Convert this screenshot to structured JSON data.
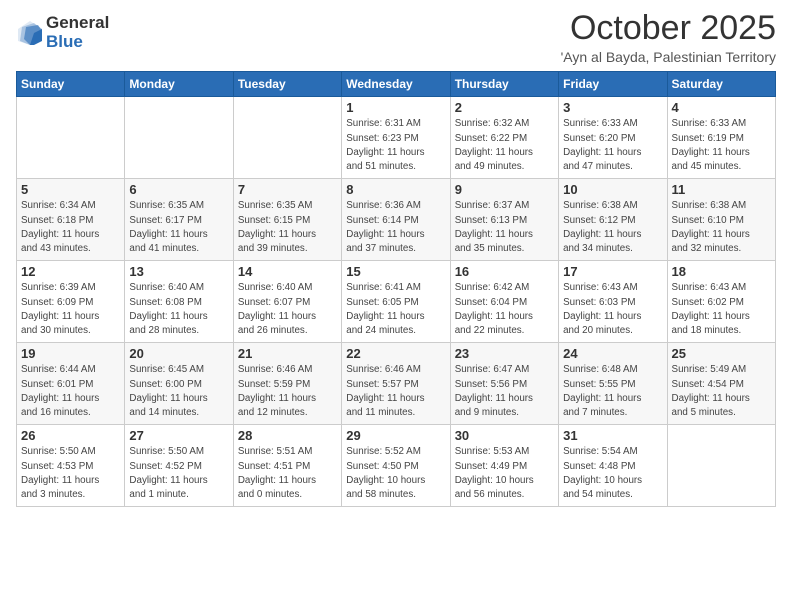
{
  "logo": {
    "general": "General",
    "blue": "Blue"
  },
  "title": "October 2025",
  "location": "'Ayn al Bayda, Palestinian Territory",
  "weekdays": [
    "Sunday",
    "Monday",
    "Tuesday",
    "Wednesday",
    "Thursday",
    "Friday",
    "Saturday"
  ],
  "weeks": [
    [
      {
        "day": "",
        "info": ""
      },
      {
        "day": "",
        "info": ""
      },
      {
        "day": "",
        "info": ""
      },
      {
        "day": "1",
        "info": "Sunrise: 6:31 AM\nSunset: 6:23 PM\nDaylight: 11 hours\nand 51 minutes."
      },
      {
        "day": "2",
        "info": "Sunrise: 6:32 AM\nSunset: 6:22 PM\nDaylight: 11 hours\nand 49 minutes."
      },
      {
        "day": "3",
        "info": "Sunrise: 6:33 AM\nSunset: 6:20 PM\nDaylight: 11 hours\nand 47 minutes."
      },
      {
        "day": "4",
        "info": "Sunrise: 6:33 AM\nSunset: 6:19 PM\nDaylight: 11 hours\nand 45 minutes."
      }
    ],
    [
      {
        "day": "5",
        "info": "Sunrise: 6:34 AM\nSunset: 6:18 PM\nDaylight: 11 hours\nand 43 minutes."
      },
      {
        "day": "6",
        "info": "Sunrise: 6:35 AM\nSunset: 6:17 PM\nDaylight: 11 hours\nand 41 minutes."
      },
      {
        "day": "7",
        "info": "Sunrise: 6:35 AM\nSunset: 6:15 PM\nDaylight: 11 hours\nand 39 minutes."
      },
      {
        "day": "8",
        "info": "Sunrise: 6:36 AM\nSunset: 6:14 PM\nDaylight: 11 hours\nand 37 minutes."
      },
      {
        "day": "9",
        "info": "Sunrise: 6:37 AM\nSunset: 6:13 PM\nDaylight: 11 hours\nand 35 minutes."
      },
      {
        "day": "10",
        "info": "Sunrise: 6:38 AM\nSunset: 6:12 PM\nDaylight: 11 hours\nand 34 minutes."
      },
      {
        "day": "11",
        "info": "Sunrise: 6:38 AM\nSunset: 6:10 PM\nDaylight: 11 hours\nand 32 minutes."
      }
    ],
    [
      {
        "day": "12",
        "info": "Sunrise: 6:39 AM\nSunset: 6:09 PM\nDaylight: 11 hours\nand 30 minutes."
      },
      {
        "day": "13",
        "info": "Sunrise: 6:40 AM\nSunset: 6:08 PM\nDaylight: 11 hours\nand 28 minutes."
      },
      {
        "day": "14",
        "info": "Sunrise: 6:40 AM\nSunset: 6:07 PM\nDaylight: 11 hours\nand 26 minutes."
      },
      {
        "day": "15",
        "info": "Sunrise: 6:41 AM\nSunset: 6:05 PM\nDaylight: 11 hours\nand 24 minutes."
      },
      {
        "day": "16",
        "info": "Sunrise: 6:42 AM\nSunset: 6:04 PM\nDaylight: 11 hours\nand 22 minutes."
      },
      {
        "day": "17",
        "info": "Sunrise: 6:43 AM\nSunset: 6:03 PM\nDaylight: 11 hours\nand 20 minutes."
      },
      {
        "day": "18",
        "info": "Sunrise: 6:43 AM\nSunset: 6:02 PM\nDaylight: 11 hours\nand 18 minutes."
      }
    ],
    [
      {
        "day": "19",
        "info": "Sunrise: 6:44 AM\nSunset: 6:01 PM\nDaylight: 11 hours\nand 16 minutes."
      },
      {
        "day": "20",
        "info": "Sunrise: 6:45 AM\nSunset: 6:00 PM\nDaylight: 11 hours\nand 14 minutes."
      },
      {
        "day": "21",
        "info": "Sunrise: 6:46 AM\nSunset: 5:59 PM\nDaylight: 11 hours\nand 12 minutes."
      },
      {
        "day": "22",
        "info": "Sunrise: 6:46 AM\nSunset: 5:57 PM\nDaylight: 11 hours\nand 11 minutes."
      },
      {
        "day": "23",
        "info": "Sunrise: 6:47 AM\nSunset: 5:56 PM\nDaylight: 11 hours\nand 9 minutes."
      },
      {
        "day": "24",
        "info": "Sunrise: 6:48 AM\nSunset: 5:55 PM\nDaylight: 11 hours\nand 7 minutes."
      },
      {
        "day": "25",
        "info": "Sunrise: 5:49 AM\nSunset: 4:54 PM\nDaylight: 11 hours\nand 5 minutes."
      }
    ],
    [
      {
        "day": "26",
        "info": "Sunrise: 5:50 AM\nSunset: 4:53 PM\nDaylight: 11 hours\nand 3 minutes."
      },
      {
        "day": "27",
        "info": "Sunrise: 5:50 AM\nSunset: 4:52 PM\nDaylight: 11 hours\nand 1 minute."
      },
      {
        "day": "28",
        "info": "Sunrise: 5:51 AM\nSunset: 4:51 PM\nDaylight: 11 hours\nand 0 minutes."
      },
      {
        "day": "29",
        "info": "Sunrise: 5:52 AM\nSunset: 4:50 PM\nDaylight: 10 hours\nand 58 minutes."
      },
      {
        "day": "30",
        "info": "Sunrise: 5:53 AM\nSunset: 4:49 PM\nDaylight: 10 hours\nand 56 minutes."
      },
      {
        "day": "31",
        "info": "Sunrise: 5:54 AM\nSunset: 4:48 PM\nDaylight: 10 hours\nand 54 minutes."
      },
      {
        "day": "",
        "info": ""
      }
    ]
  ]
}
